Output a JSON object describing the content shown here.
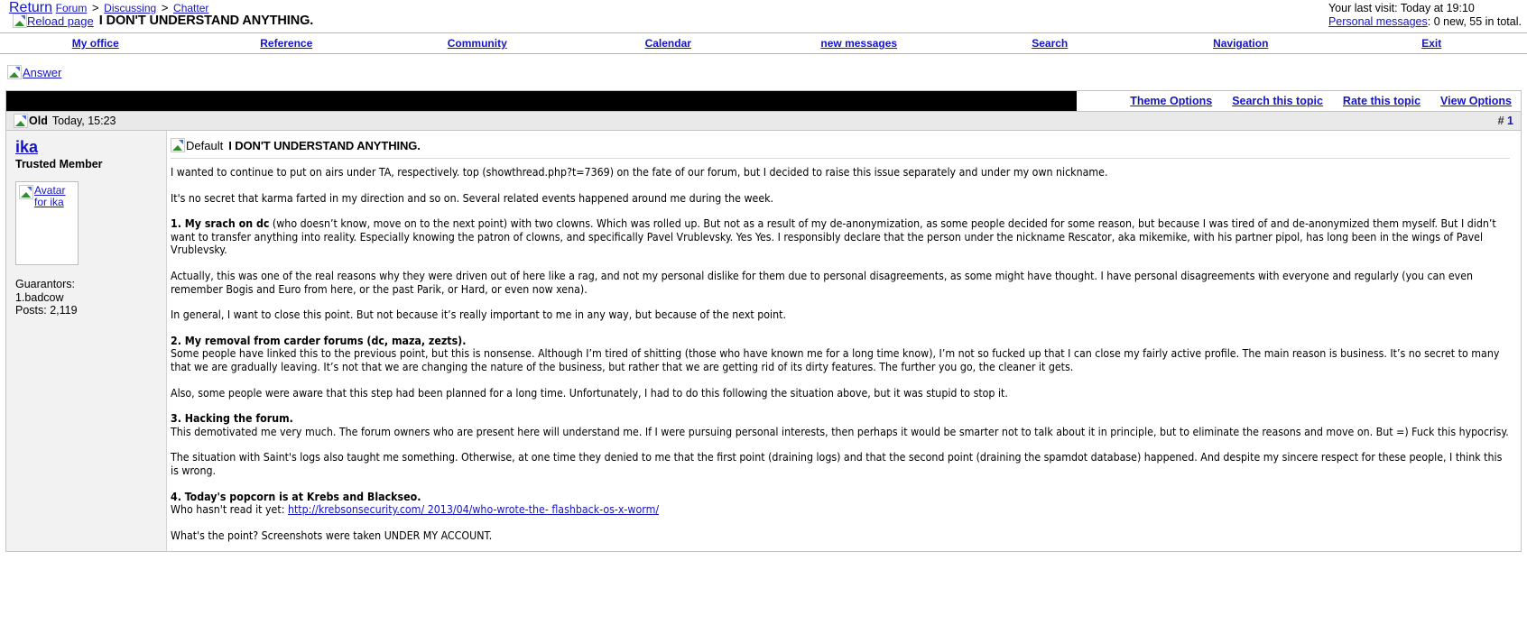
{
  "header": {
    "return_label": "Return",
    "breadcrumb": [
      {
        "label": "Forum"
      },
      {
        "label": "Discussing"
      },
      {
        "label": "Chatter"
      }
    ],
    "separator": ">",
    "reload_label": "Reload page",
    "thread_title": "I DON'T UNDERSTAND ANYTHING.",
    "last_visit": "Your last visit: Today at 19:10",
    "pm_link_label": "Personal messages",
    "pm_status": ": 0 new, 55 in total."
  },
  "nav": {
    "items": [
      {
        "label": "My office"
      },
      {
        "label": "Reference"
      },
      {
        "label": "Community"
      },
      {
        "label": "Calendar"
      },
      {
        "label": "new messages"
      },
      {
        "label": "Search"
      },
      {
        "label": "Navigation"
      },
      {
        "label": "Exit"
      }
    ]
  },
  "actions": {
    "answer_label": "Answer"
  },
  "thread_toolbar": {
    "items": [
      {
        "label": "Theme Options"
      },
      {
        "label": "Search this topic"
      },
      {
        "label": "Rate this topic"
      },
      {
        "label": "View Options"
      }
    ]
  },
  "post": {
    "status_label": "Old",
    "datetime": "Today, 15:23",
    "hash": "#",
    "number": "1",
    "author": {
      "name": "ika",
      "title": "Trusted Member",
      "avatar_alt": "Avatar for ika",
      "guarantors_label": "Guarantors:",
      "guarantor_1": "1.badcow",
      "posts": "Posts: 2,119"
    },
    "icon_label": "Default",
    "subject": "I DON'T UNDERSTAND ANYTHING.",
    "paragraphs": [
      {
        "type": "plain",
        "text": "I wanted to continue to put on airs under TA, respectively. top (showthread.php?t=7369) on the fate of our forum, but I decided to raise this issue separately and under my own nickname."
      },
      {
        "type": "plain",
        "text": "It's no secret that karma farted in my direction and so on. Several related events happened around me during the week."
      },
      {
        "type": "lead-bold",
        "bold": "1. My srach on dc",
        "text": " (who doesn’t know, move on to the next point) with two clowns. Which was rolled up. But not as a result of my de-anonymization, as some people decided for some reason, but because I was tired of and de-anonymized them myself. But I didn’t want to transfer anything into reality. Especially knowing the patron of clowns, and specifically Pavel Vrublevsky. Yes Yes. I responsibly declare that the person under the nickname Rescator, aka mikemike, with his partner pipol, has long been in the wings of Pavel Vrublevsky."
      },
      {
        "type": "plain",
        "text": "Actually, this was one of the real reasons why they were driven out of here like a rag, and not my personal dislike for them due to personal disagreements, as some might have thought. I have personal disagreements with everyone and regularly (you can even remember Bogis and Euro from here, or the past Parik, or Hard, or even now xena)."
      },
      {
        "type": "plain",
        "text": "In general, I want to close this point. But not because it’s really important to me in any way, but because of the next point."
      },
      {
        "type": "heading-bold",
        "bold": "2. My removal from carder forums (dc, maza, zezts).",
        "text": "Some people have linked this to the previous point, but this is nonsense. Although I’m tired of shitting (those who have known me for a long time know), I’m not so fucked up that I can close my fairly active profile. The main reason is business. It’s no secret to many that we are gradually leaving. It’s not that we are changing the nature of the business, but rather that we are getting rid of its dirty features. The further you go, the cleaner it gets."
      },
      {
        "type": "plain",
        "text": "Also, some people were aware that this step had been planned for a long time. Unfortunately, I had to do this following the situation above, but it was stupid to stop it."
      },
      {
        "type": "heading-bold",
        "bold": "3. Hacking the forum.",
        "text": "This demotivated me very much. The forum owners who are present here will understand me. If I were pursuing personal interests, then perhaps it would be smarter not to talk about it in principle, but to eliminate the reasons and move on. But =) Fuck this hypocrisy."
      },
      {
        "type": "plain",
        "text": "The situation with Saint's logs also taught me something. Otherwise, at one time they denied to me that the first point (draining logs) and that the second point (draining the spamdot database) happened. And despite my sincere respect for these people, I think this is wrong."
      },
      {
        "type": "heading-link",
        "bold": "4. Today's popcorn is at Krebs and Blackseo.",
        "text": "Who hasn't read it yet: ",
        "link": "http://krebsonsecurity.com/ 2013/04/who-wrote-the- flashback-os-x-worm/"
      },
      {
        "type": "plain",
        "text": "What's the point? Screenshots were taken UNDER MY ACCOUNT."
      }
    ]
  }
}
